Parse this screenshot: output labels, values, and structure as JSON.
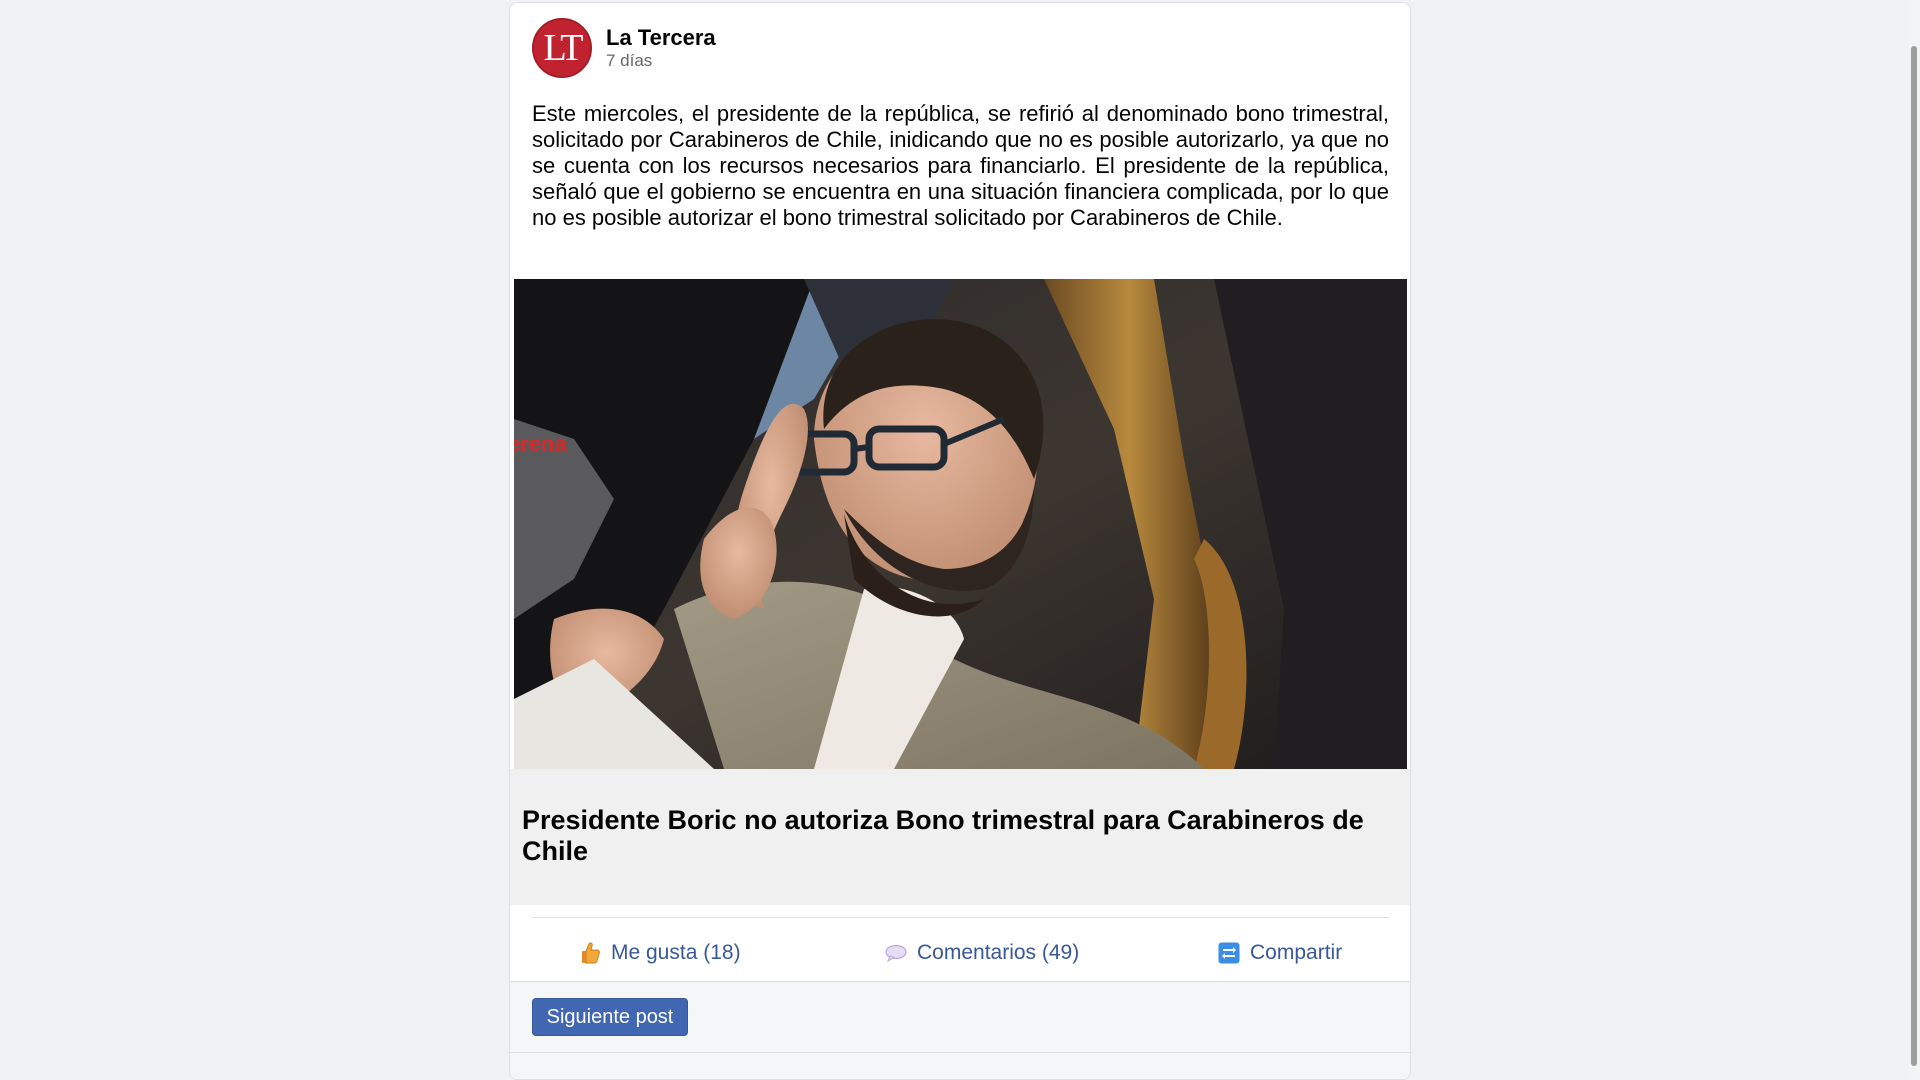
{
  "post": {
    "author": {
      "name": "La Tercera",
      "avatar_text": "LT",
      "avatar_color": "#c0232f"
    },
    "timestamp": "7 días",
    "body": "Este miercoles, el presidente de la república, se refirió al denominado bono trimestral, solicitado por Carabineros de Chile, inidicando que no es posible autorizarlo, ya que no se cuenta con los recursos necesarios para financiarlo. El presidente de la república, señaló que el gobierno se encuentra en una situación financiera complicada, por lo que no es posible autorizar el bono trimestral solicitado por Carabineros de Chile.",
    "image": {
      "watermark": "erena"
    },
    "link_preview": {
      "title": "Presidente Boric no autoriza Bono trimestral para Carabineros de Chile"
    },
    "actions": {
      "like": {
        "label": "Me gusta (18)",
        "icon": "thumbs-up-icon"
      },
      "comment": {
        "label": "Comentarios (49)",
        "icon": "speech-bubble-icon"
      },
      "share": {
        "label": "Compartir",
        "icon": "share-icon"
      }
    },
    "next_button": {
      "label": "Siguiente post"
    }
  },
  "colors": {
    "page_background": "#f0f2f5",
    "link_blue": "#385898",
    "button_blue": "#4267b2"
  }
}
